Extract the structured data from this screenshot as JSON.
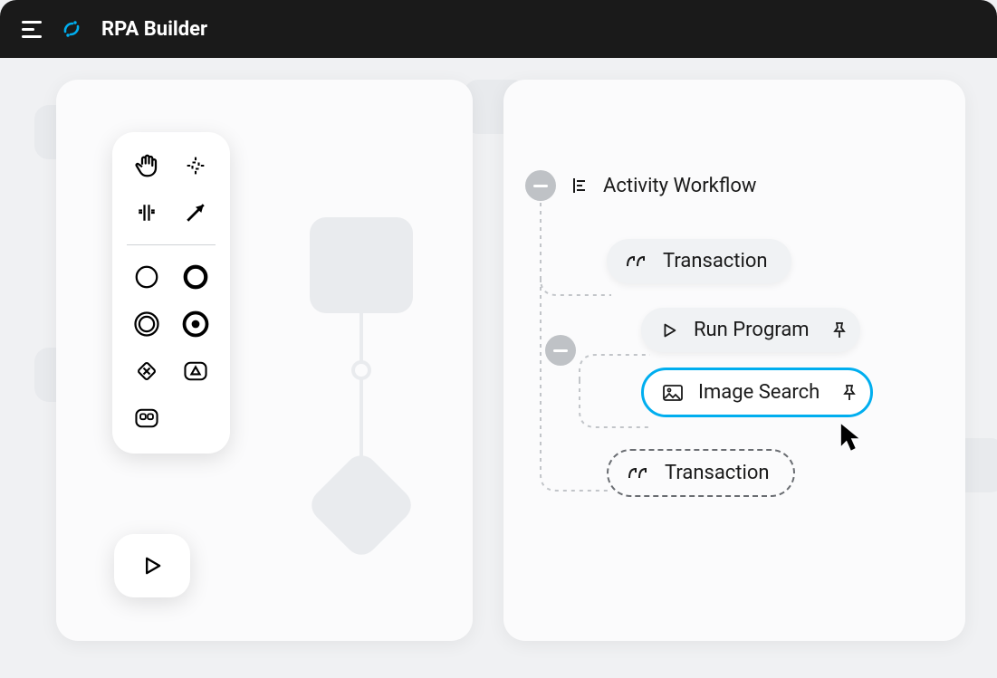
{
  "header": {
    "title": "RPA Builder"
  },
  "palette_tools": [
    "hand-tool",
    "crop-tool",
    "split-tool",
    "connector-tool",
    "divider",
    "circle-tool",
    "circle-bold-tool",
    "double-circle-tool",
    "target-tool",
    "diamond-tool",
    "triangle-box-tool",
    "grouped-box-tool"
  ],
  "tree": {
    "root_label": "Activity Workflow",
    "transaction_label": "Transaction",
    "children": [
      {
        "icon": "play-icon",
        "label": "Run Program",
        "pinned": true,
        "active": false
      },
      {
        "icon": "image-icon",
        "label": "Image Search",
        "pinned": true,
        "active": true
      }
    ],
    "trailing_drop_label": "Transaction"
  }
}
